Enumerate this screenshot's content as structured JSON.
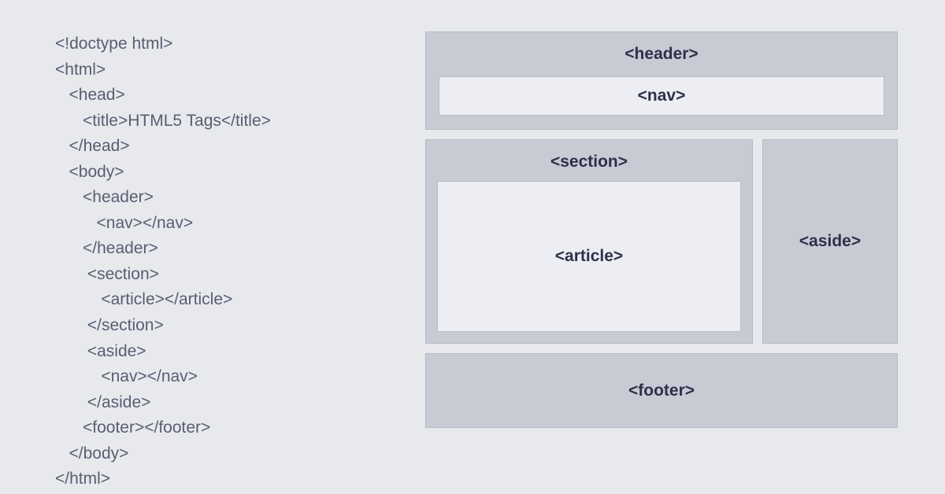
{
  "code": {
    "lines": [
      "<!doctype html>",
      "<html>",
      "   <head>",
      "      <title>HTML5 Tags</title>",
      "   </head>",
      "   <body>",
      "      <header>",
      "         <nav></nav>",
      "      </header>",
      "       <section>",
      "          <article></article>",
      "       </section>",
      "       <aside>",
      "          <nav></nav>",
      "       </aside>",
      "      <footer></footer>",
      "   </body>",
      "</html>"
    ]
  },
  "layout": {
    "header": "<header>",
    "nav": "<nav>",
    "section": "<section>",
    "article": "<article>",
    "aside": "<aside>",
    "footer": "<footer>"
  }
}
